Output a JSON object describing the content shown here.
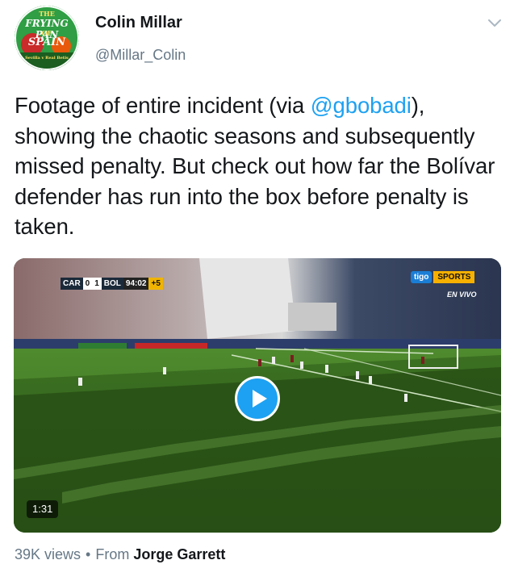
{
  "author": {
    "name": "Colin Millar",
    "handle": "@Millar_Colin",
    "avatar": {
      "line1": "THE",
      "line2": "FRYING PAN",
      "line3": "OF",
      "line4": "SPAIN",
      "line5": "Sevilla v Real Betis"
    }
  },
  "tweet": {
    "text_before": "Footage of entire incident (via ",
    "mention": "@gbobadi",
    "text_after": "), showing the chaotic seasons and subsequently missed penalty. But check out how far the Bolívar defender has run into the box before penalty is taken."
  },
  "video": {
    "scorebug": {
      "home": "CAR",
      "home_score": "0",
      "away_score": "1",
      "away": "BOL",
      "time": "94:02",
      "added": "+5"
    },
    "brand": {
      "tigo": "tigo",
      "sports": "SPORTS",
      "live": "EN VIVO"
    },
    "duration": "1:31"
  },
  "meta": {
    "views": "39K views",
    "separator": "•",
    "from_label": "From",
    "from_name": "Jorge Garrett"
  },
  "colors": {
    "link": "#1da1f2",
    "secondary_text": "#657786",
    "primary_text": "#14171a",
    "play_button": "#1da1f2"
  },
  "icons": {
    "chevron": "chevron-down-icon",
    "play": "play-icon"
  }
}
